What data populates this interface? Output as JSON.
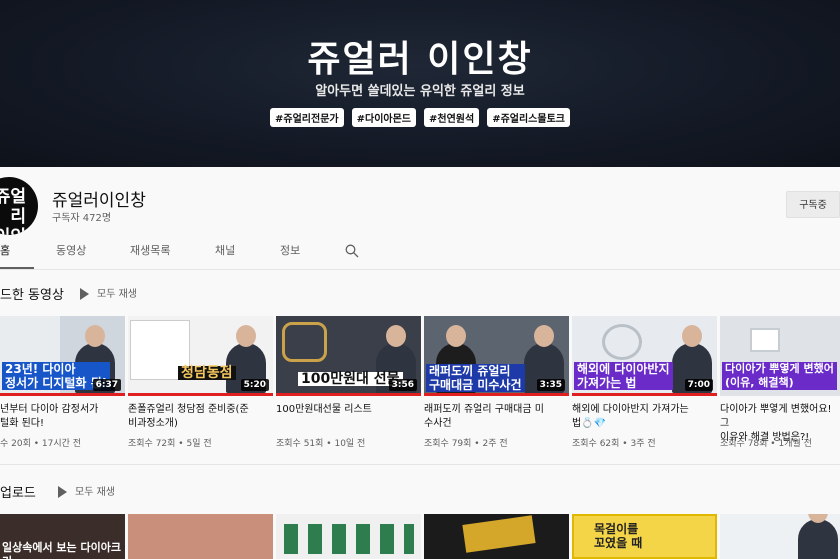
{
  "banner": {
    "title": "쥬얼러 이인창",
    "subtitle": "알아두면 쓸데있는 유익한 쥬얼리 정보",
    "tags": [
      "#쥬얼리전문가",
      "#다이아몬드",
      "#천연원석",
      "#쥬얼리스몰토크"
    ]
  },
  "channel": {
    "avatar_text": "쥬얼리\n이인창",
    "name": "쥬얼러이인창",
    "subscribers": "구독자 472명",
    "subscribe_label": "구독중"
  },
  "tabs": [
    "홈",
    "동영상",
    "재생목록",
    "채널",
    "정보"
  ],
  "sections": {
    "uploaded_recent": {
      "title": "드한 동영상",
      "play_all": "모두 재생"
    },
    "uploads": {
      "title": "업로드",
      "play_all": "모두 재생"
    }
  },
  "videos": [
    {
      "title": "년부터 다이아 감정서가\n털화 된다!",
      "meta": "수 20회 • 17시간 전",
      "duration": "6:37",
      "caption": "23년! 다이아\n정서가 디지털화 된!"
    },
    {
      "title": "존폴쥬얼리 청담점 준비중(준\n비과정소개)",
      "meta": "조회수 72회 • 5일 전",
      "duration": "5:20",
      "caption": "청담동점"
    },
    {
      "title": "100만원대선물 리스트",
      "meta": "조회수 51회 • 10일 전",
      "duration": "3:56",
      "caption": "100만원대 선물"
    },
    {
      "title": "래퍼도끼 쥬얼리 구매대금 미\n수사건",
      "meta": "조회수 79회 • 2주 전",
      "duration": "3:35",
      "caption": "래퍼도끼 쥬얼리\n구매대금 미수사건"
    },
    {
      "title": "해외에 다이아반지 가져가는\n법💍💎",
      "meta": "조회수 62회 • 3주 전",
      "duration": "7:00",
      "caption": "해외에 다이아반지\n가져가는 법"
    },
    {
      "title": "다이아가 뿌옇게 변했어요! 그\n이유와 해결 방법은?!",
      "meta": "조회수 78회 • 1개월 전",
      "duration": "",
      "caption": "다이아가 뿌옇게 변했어\n(이유, 해결책)"
    }
  ],
  "upload_captions": [
    "일상속에서 보는 다이아크기",
    "",
    "",
    "",
    "목걸이를\n꼬였을 때",
    ""
  ],
  "colors": {
    "banner_bg": "#141a26",
    "progress_red": "#e02020"
  }
}
